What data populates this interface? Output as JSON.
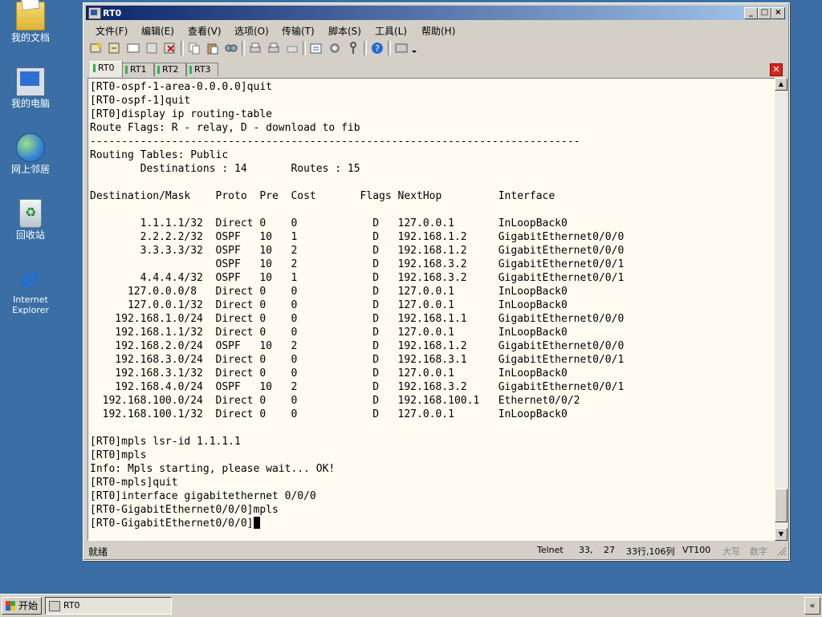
{
  "desktop": {
    "icons": [
      {
        "label": "我的文档",
        "icon": "my-documents-icon"
      },
      {
        "label": "我的电脑",
        "icon": "my-computer-icon"
      },
      {
        "label": "网上邻居",
        "icon": "network-places-icon"
      },
      {
        "label": "回收站",
        "icon": "recycle-bin-icon"
      },
      {
        "label": "Internet Explorer",
        "icon": "internet-explorer-icon"
      }
    ]
  },
  "window": {
    "title": "RT0",
    "menu": [
      "文件(F)",
      "编辑(E)",
      "查看(V)",
      "选项(O)",
      "传输(T)",
      "脚本(S)",
      "工具(L)",
      "帮助(H)"
    ],
    "tabs": [
      "RT0",
      "RT1",
      "RT2",
      "RT3"
    ],
    "active_tab": "RT0"
  },
  "terminal": {
    "lines": [
      "[RT0-ospf-1-area-0.0.0.0]quit",
      "[RT0-ospf-1]quit",
      "[RT0]display ip routing-table",
      "Route Flags: R - relay, D - download to fib",
      "------------------------------------------------------------------------------",
      "Routing Tables: Public",
      "        Destinations : 14       Routes : 15",
      "",
      "Destination/Mask    Proto  Pre  Cost       Flags NextHop         Interface",
      "",
      "        1.1.1.1/32  Direct 0    0            D   127.0.0.1       InLoopBack0",
      "        2.2.2.2/32  OSPF   10   1            D   192.168.1.2     GigabitEthernet0/0/0",
      "        3.3.3.3/32  OSPF   10   2            D   192.168.1.2     GigabitEthernet0/0/0",
      "                    OSPF   10   2            D   192.168.3.2     GigabitEthernet0/0/1",
      "        4.4.4.4/32  OSPF   10   1            D   192.168.3.2     GigabitEthernet0/0/1",
      "      127.0.0.0/8   Direct 0    0            D   127.0.0.1       InLoopBack0",
      "      127.0.0.1/32  Direct 0    0            D   127.0.0.1       InLoopBack0",
      "    192.168.1.0/24  Direct 0    0            D   192.168.1.1     GigabitEthernet0/0/0",
      "    192.168.1.1/32  Direct 0    0            D   127.0.0.1       InLoopBack0",
      "    192.168.2.0/24  OSPF   10   2            D   192.168.1.2     GigabitEthernet0/0/0",
      "    192.168.3.0/24  Direct 0    0            D   192.168.3.1     GigabitEthernet0/0/1",
      "    192.168.3.1/32  Direct 0    0            D   127.0.0.1       InLoopBack0",
      "    192.168.4.0/24  OSPF   10   2            D   192.168.3.2     GigabitEthernet0/0/1",
      "  192.168.100.0/24  Direct 0    0            D   192.168.100.1   Ethernet0/0/2",
      "  192.168.100.1/32  Direct 0    0            D   127.0.0.1       InLoopBack0",
      "",
      "[RT0]mpls lsr-id 1.1.1.1",
      "[RT0]mpls",
      "Info: Mpls starting, please wait... OK!",
      "[RT0-mpls]quit",
      "[RT0]interface gigabitethernet 0/0/0",
      "[RT0-GigabitEthernet0/0/0]mpls",
      "[RT0-GigabitEthernet0/0/0]"
    ]
  },
  "statusbar": {
    "status": "就绪",
    "protocol": "Telnet",
    "row": "33,",
    "col": "27",
    "position": "33行,106列",
    "emulation": "VT100",
    "caps": "大写",
    "num": "数字"
  },
  "taskbar": {
    "start_label": "开始",
    "task_label": "RT0"
  },
  "colors": {
    "desktop": "#3a6ea5",
    "terminal_bg": "#fffbf0",
    "title_gradient_start": "#0a246a"
  }
}
